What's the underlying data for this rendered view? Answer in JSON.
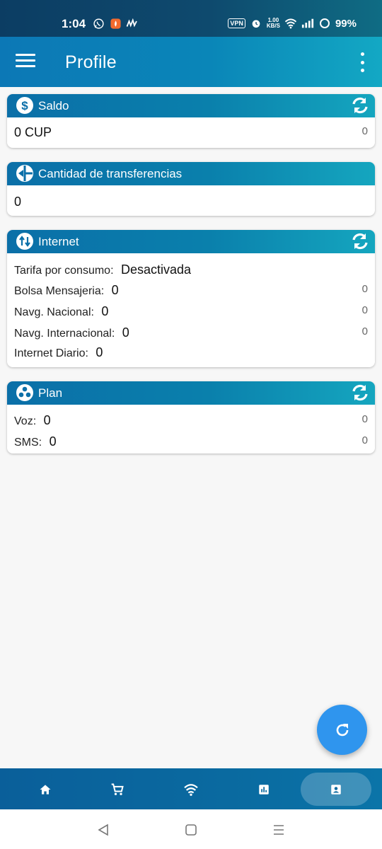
{
  "status_bar": {
    "time": "1:04",
    "vpn": "VPN",
    "net_speed_value": "1.00",
    "net_speed_unit": "KB/S",
    "battery": "99%"
  },
  "app_bar": {
    "title": "Profile"
  },
  "saldo": {
    "title": "Saldo",
    "value": "0 CUP",
    "side": "0"
  },
  "transferencias": {
    "title": "Cantidad de transferencias",
    "value": "0"
  },
  "internet": {
    "title": "Internet",
    "rows": [
      {
        "label": "Tarifa por consumo:",
        "value": "Desactivada",
        "side": ""
      },
      {
        "label": "Bolsa Mensajeria:",
        "value": "0",
        "side": "0"
      },
      {
        "label": "Navg. Nacional:",
        "value": "0",
        "side": "0"
      },
      {
        "label": "Navg. Internacional:",
        "value": "0",
        "side": "0"
      },
      {
        "label": "Internet Diario:",
        "value": "0",
        "side": ""
      }
    ]
  },
  "plan": {
    "title": "Plan",
    "rows": [
      {
        "label": "Voz:",
        "value": "0",
        "side": "0"
      },
      {
        "label": "SMS:",
        "value": "0",
        "side": "0"
      }
    ]
  },
  "bottom_nav": {
    "items": [
      "home-icon",
      "cart-icon",
      "wifi-icon",
      "chart-icon",
      "profile-card-icon"
    ],
    "active": "profile-card-icon"
  },
  "colors": {
    "header_start": "#0b6fa8",
    "header_end": "#15a6bf",
    "fab": "#2f95ee"
  }
}
